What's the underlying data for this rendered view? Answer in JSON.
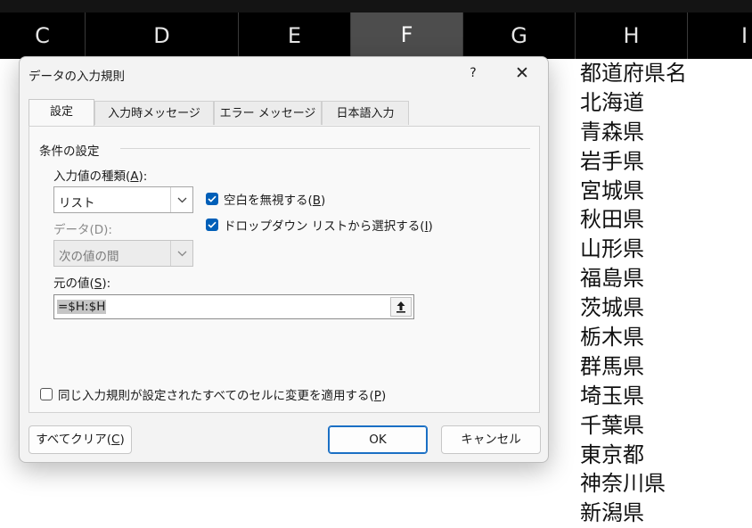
{
  "spreadsheet": {
    "columns": [
      "C",
      "D",
      "E",
      "F",
      "G",
      "H",
      "I"
    ],
    "selected_column": "F",
    "column_h_cells": [
      "都道府県名",
      "北海道",
      "青森県",
      "岩手県",
      "宮城県",
      "秋田県",
      "山形県",
      "福島県",
      "茨城県",
      "栃木県",
      "群馬県",
      "埼玉県",
      "千葉県",
      "東京都",
      "神奈川県",
      "新潟県"
    ]
  },
  "dialog": {
    "title": "データの入力規則",
    "help_label": "?",
    "close_label": "✕",
    "tabs": [
      "設定",
      "入力時メッセージ",
      "エラー メッセージ",
      "日本語入力"
    ],
    "active_tab": "設定",
    "group_title": "条件の設定",
    "allow_label": "入力値の種類(",
    "allow_key": "A",
    "allow_label_end": "):",
    "allow_value": "リスト",
    "data_label": "データ(D):",
    "data_value": "次の値の間",
    "ignore_blank": {
      "label": "空白を無視する(",
      "key": "B",
      "end": ")",
      "checked": true
    },
    "in_cell_dropdown": {
      "label": "ドロップダウン リストから選択する(",
      "key": "I",
      "end": ")",
      "checked": true
    },
    "source_label": "元の値(",
    "source_key": "S",
    "source_label_end": "):",
    "source_value": "=$H:$H",
    "apply_all": {
      "label": "同じ入力規則が設定されたすべてのセルに変更を適用する(",
      "key": "P",
      "end": ")",
      "checked": false
    },
    "clear_all": {
      "label": "すべてクリア(",
      "key": "C",
      "end": ")"
    },
    "ok_label": "OK",
    "cancel_label": "キャンセル"
  },
  "colors": {
    "accent": "#005fb8",
    "header_bg": "#000000",
    "selected_header_bg": "#4d4d4d"
  }
}
